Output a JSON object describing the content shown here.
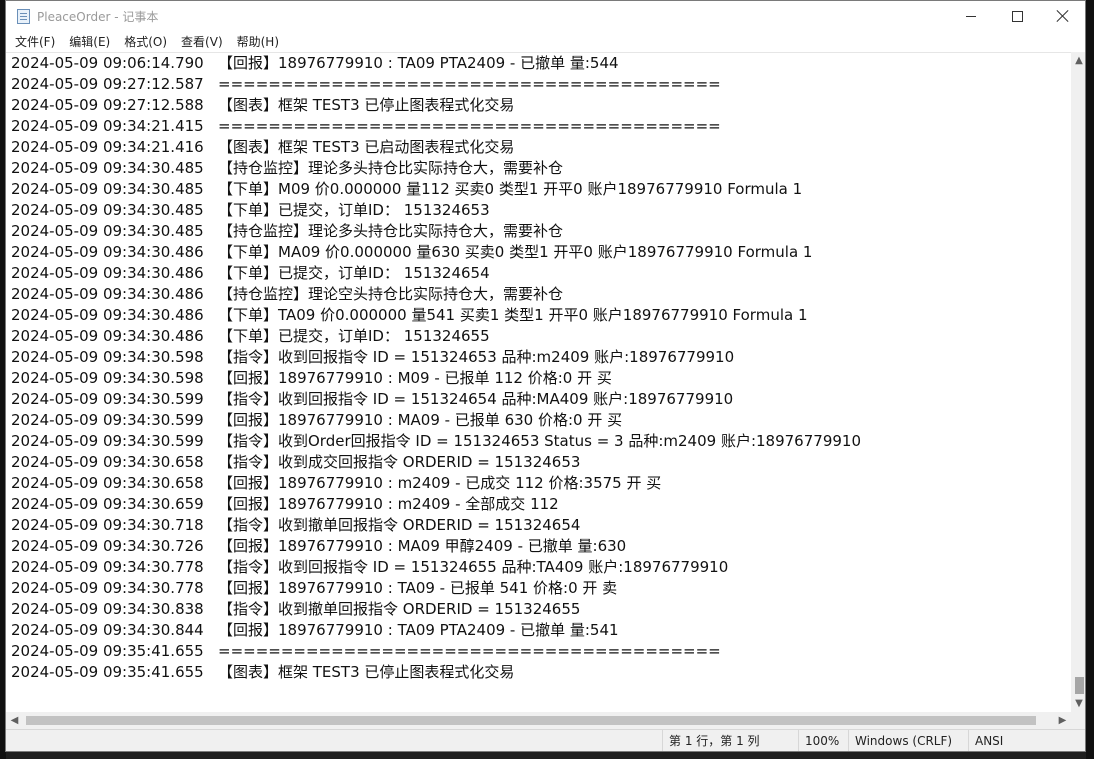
{
  "window": {
    "title": "PleaceOrder - 记事本",
    "icon": "notepad-icon",
    "controls": {
      "minimize": "minimize-icon",
      "maximize": "maximize-icon",
      "close": "close-icon"
    }
  },
  "menu": [
    "文件(F)",
    "编辑(E)",
    "格式(O)",
    "查看(V)",
    "帮助(H)"
  ],
  "lines": [
    {
      "ts": "2024-05-09 09:06:14.790",
      "msg": "【回报】18976779910 : TA09 PTA2409 - 已撤单 量:544"
    },
    {
      "ts": "2024-05-09 09:27:12.587",
      "msg": "========================================"
    },
    {
      "ts": "2024-05-09 09:27:12.588",
      "msg": "【图表】框架 TEST3 已停止图表程式化交易"
    },
    {
      "ts": "2024-05-09 09:34:21.415",
      "msg": "========================================"
    },
    {
      "ts": "2024-05-09 09:34:21.416",
      "msg": "【图表】框架 TEST3 已启动图表程式化交易"
    },
    {
      "ts": "2024-05-09 09:34:30.485",
      "msg": "【持仓监控】理论多头持仓比实际持仓大，需要补仓"
    },
    {
      "ts": "2024-05-09 09:34:30.485",
      "msg": "【下单】M09 价0.000000 量112 买卖0 类型1 开平0 账户18976779910 Formula 1"
    },
    {
      "ts": "2024-05-09 09:34:30.485",
      "msg": "【下单】已提交，订单ID： 151324653"
    },
    {
      "ts": "2024-05-09 09:34:30.485",
      "msg": "【持仓监控】理论多头持仓比实际持仓大，需要补仓"
    },
    {
      "ts": "2024-05-09 09:34:30.486",
      "msg": "【下单】MA09 价0.000000 量630 买卖0 类型1 开平0 账户18976779910 Formula 1"
    },
    {
      "ts": "2024-05-09 09:34:30.486",
      "msg": "【下单】已提交，订单ID： 151324654"
    },
    {
      "ts": "2024-05-09 09:34:30.486",
      "msg": "【持仓监控】理论空头持仓比实际持仓大，需要补仓"
    },
    {
      "ts": "2024-05-09 09:34:30.486",
      "msg": "【下单】TA09 价0.000000 量541 买卖1 类型1 开平0 账户18976779910 Formula 1"
    },
    {
      "ts": "2024-05-09 09:34:30.486",
      "msg": "【下单】已提交，订单ID： 151324655"
    },
    {
      "ts": "2024-05-09 09:34:30.598",
      "msg": "【指令】收到回报指令 ID = 151324653 品种:m2409 账户:18976779910"
    },
    {
      "ts": "2024-05-09 09:34:30.598",
      "msg": "【回报】18976779910 : M09 - 已报单 112 价格:0 开 买"
    },
    {
      "ts": "2024-05-09 09:34:30.599",
      "msg": "【指令】收到回报指令 ID = 151324654 品种:MA409 账户:18976779910"
    },
    {
      "ts": "2024-05-09 09:34:30.599",
      "msg": "【回报】18976779910 : MA09 - 已报单 630 价格:0 开 买"
    },
    {
      "ts": "2024-05-09 09:34:30.599",
      "msg": "【指令】收到Order回报指令 ID = 151324653 Status = 3 品种:m2409 账户:18976779910"
    },
    {
      "ts": "2024-05-09 09:34:30.658",
      "msg": "【指令】收到成交回报指令 ORDERID = 151324653"
    },
    {
      "ts": "2024-05-09 09:34:30.658",
      "msg": "【回报】18976779910 : m2409 - 已成交 112 价格:3575 开 买"
    },
    {
      "ts": "2024-05-09 09:34:30.659",
      "msg": "【回报】18976779910 : m2409 - 全部成交 112"
    },
    {
      "ts": "2024-05-09 09:34:30.718",
      "msg": "【指令】收到撤单回报指令 ORDERID = 151324654"
    },
    {
      "ts": "2024-05-09 09:34:30.726",
      "msg": "【回报】18976779910 : MA09 甲醇2409 - 已撤单 量:630"
    },
    {
      "ts": "2024-05-09 09:34:30.778",
      "msg": "【指令】收到回报指令 ID = 151324655 品种:TA409 账户:18976779910"
    },
    {
      "ts": "2024-05-09 09:34:30.778",
      "msg": "【回报】18976779910 : TA09 - 已报单 541 价格:0 开 卖"
    },
    {
      "ts": "2024-05-09 09:34:30.838",
      "msg": "【指令】收到撤单回报指令 ORDERID = 151324655"
    },
    {
      "ts": "2024-05-09 09:34:30.844",
      "msg": "【回报】18976779910 : TA09 PTA2409 - 已撤单 量:541"
    },
    {
      "ts": "2024-05-09 09:35:41.655",
      "msg": "========================================"
    },
    {
      "ts": "2024-05-09 09:35:41.655",
      "msg": "【图表】框架 TEST3 已停止图表程式化交易"
    }
  ],
  "status": {
    "position": "第 1 行，第 1 列",
    "zoom": "100%",
    "line_ending": "Windows (CRLF)",
    "encoding": "ANSI"
  }
}
